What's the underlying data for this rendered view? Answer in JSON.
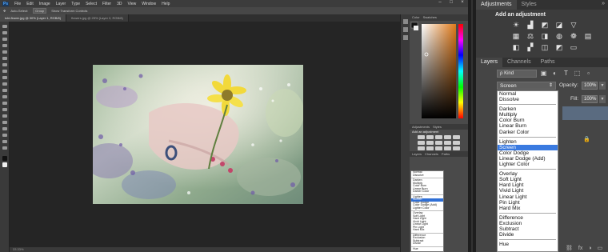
{
  "app": {
    "logo": "Ps",
    "menu": [
      "File",
      "Edit",
      "Image",
      "Layer",
      "Type",
      "Select",
      "Filter",
      "3D",
      "View",
      "Window",
      "Help"
    ],
    "window_controls": [
      "–",
      "□",
      "×"
    ]
  },
  "options_bar": {
    "items": [
      "Auto-Select:",
      "Group",
      "Show Transform Controls"
    ]
  },
  "document_tabs": [
    {
      "label": "tcbi-flower.jpg @ 30% (Layer 1, RGB/8)",
      "active": true
    },
    {
      "label": "flowers.jpg @ 25% (Layer 0, RGB/8)",
      "active": false
    }
  ],
  "status_bar": {
    "text": "33.33%"
  },
  "mini_panels": {
    "color_tabs": [
      "Color",
      "Swatches"
    ],
    "adj_tabs": [
      "Adjustments",
      "Styles"
    ],
    "adj_title": "Add an adjustment",
    "layer_tabs": [
      "Layers",
      "Channels",
      "Paths"
    ],
    "blend_items": [
      "Normal",
      "Dissolve",
      "|",
      "Darken",
      "Multiply",
      "Color Burn",
      "Linear Burn",
      "Darker Color",
      "|",
      "Lighten",
      "Screen",
      "Color Dodge",
      "Color Dodge (Add)",
      "Lighter Color",
      "|",
      "Overlay",
      "Soft Light",
      "Hard Light",
      "Vivid Light",
      "Linear Light",
      "Pin Light",
      "Hard Mix",
      "|",
      "Difference",
      "Exclusion",
      "Subtract",
      "Divide",
      "|",
      "Hue"
    ],
    "selected": "Screen"
  },
  "zoom": {
    "top_tabs": [
      "Adjustments",
      "Styles"
    ],
    "panel_menu": "»",
    "adjustments_title": "Add an adjustment",
    "adjustment_icons": [
      {
        "name": "brightness-contrast-icon",
        "glyph": "☀"
      },
      {
        "name": "levels-icon",
        "glyph": "▟"
      },
      {
        "name": "curves-icon",
        "glyph": "◩"
      },
      {
        "name": "exposure-icon",
        "glyph": "◪"
      },
      {
        "name": "vibrance-icon",
        "glyph": "▽"
      },
      {
        "name": "spacer",
        "glyph": ""
      },
      {
        "name": "hue-saturation-icon",
        "glyph": "▦"
      },
      {
        "name": "color-balance-icon",
        "glyph": "⚖"
      },
      {
        "name": "black-white-icon",
        "glyph": "◨"
      },
      {
        "name": "photo-filter-icon",
        "glyph": "◍"
      },
      {
        "name": "channel-mixer-icon",
        "glyph": "❁"
      },
      {
        "name": "color-lookup-icon",
        "glyph": "▤"
      },
      {
        "name": "invert-icon",
        "glyph": "◧"
      },
      {
        "name": "posterize-icon",
        "glyph": "▞"
      },
      {
        "name": "threshold-icon",
        "glyph": "◫"
      },
      {
        "name": "selective-color-icon",
        "glyph": "◩"
      },
      {
        "name": "gradient-map-icon",
        "glyph": "▭"
      },
      {
        "name": "spacer2",
        "glyph": ""
      }
    ],
    "layers_tabs": [
      "Layers",
      "Channels",
      "Paths"
    ],
    "kind_filter": "ρ Kind",
    "filter_icons": [
      "▣",
      "◐",
      "T",
      "⬚",
      "▫"
    ],
    "blend_mode": "Screen",
    "opacity_label": "Opacity:",
    "opacity_value": "100%",
    "fill_label": "Fill:",
    "fill_value": "100%",
    "blend_options": [
      "Normal",
      "Dissolve",
      "|",
      "Darken",
      "Multiply",
      "Color Burn",
      "Linear Burn",
      "Darker Color",
      "|",
      "Lighten",
      "Screen",
      "Color Dodge",
      "Linear Dodge (Add)",
      "Lighter Color",
      "|",
      "Overlay",
      "Soft Light",
      "Hard Light",
      "Vivid Light",
      "Linear Light",
      "Pin Light",
      "Hard Mix",
      "|",
      "Difference",
      "Exclusion",
      "Subtract",
      "Divide",
      "|",
      "Hue"
    ],
    "footer_icons": [
      "⛓",
      "fx",
      "◑",
      "▭",
      "▤",
      "🗑"
    ]
  },
  "colors": {
    "accent_selected": "#3a7ae0",
    "panel_bg": "#454545",
    "app_bg": "#282828"
  }
}
